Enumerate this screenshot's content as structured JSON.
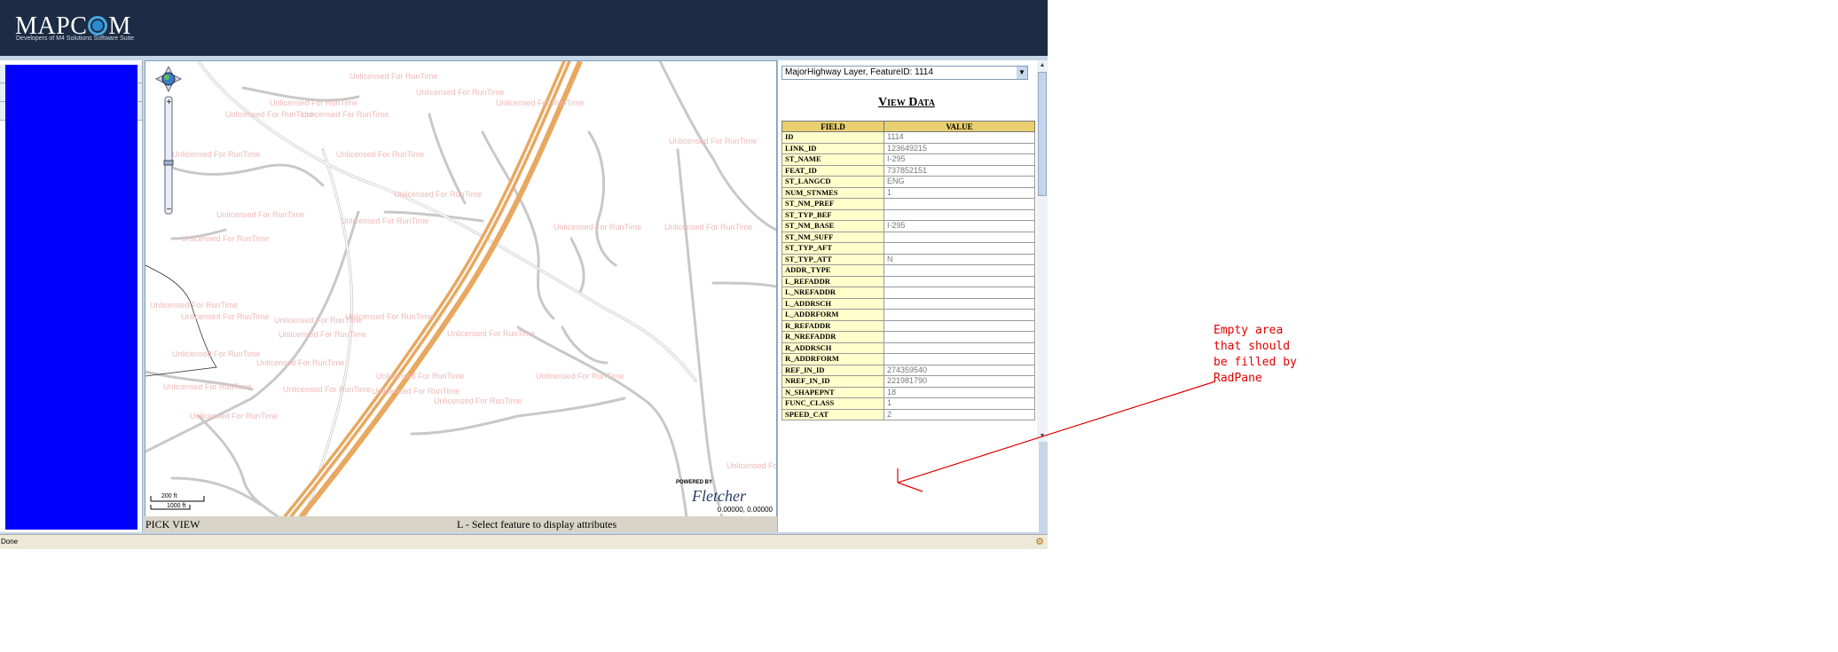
{
  "header": {
    "logo": "MAPCOM",
    "tagline": "Developers of M4 Solutions Software Suite"
  },
  "map": {
    "watermark": "Unlicensed For RunTime",
    "status_mode": "PICK  VIEW",
    "status_message": "L - Select feature to display attributes",
    "coords": "0.00000, 0.00000",
    "scale_labels": [
      "200 ft",
      "1000 ft"
    ],
    "powered_by": "POWERED BY",
    "brand": "Fletcher"
  },
  "attributes": {
    "layer_select": "MajorHighway Layer, FeatureID: 1114",
    "title": "View Data",
    "columns": [
      "FIELD",
      "VALUE"
    ],
    "rows": [
      [
        "ID",
        "1114"
      ],
      [
        "LINK_ID",
        "123649215"
      ],
      [
        "ST_NAME",
        "I-295"
      ],
      [
        "FEAT_ID",
        "737852151"
      ],
      [
        "ST_LANGCD",
        "ENG"
      ],
      [
        "NUM_STNMES",
        "1"
      ],
      [
        "ST_NM_PREF",
        ""
      ],
      [
        "ST_TYP_BEF",
        ""
      ],
      [
        "ST_NM_BASE",
        "I-295"
      ],
      [
        "ST_NM_SUFF",
        ""
      ],
      [
        "ST_TYP_AFT",
        ""
      ],
      [
        "ST_TYP_ATT",
        "N"
      ],
      [
        "ADDR_TYPE",
        ""
      ],
      [
        "L_REFADDR",
        ""
      ],
      [
        "L_NREFADDR",
        ""
      ],
      [
        "L_ADDRSCH",
        ""
      ],
      [
        "L_ADDRFORM",
        ""
      ],
      [
        "R_REFADDR",
        ""
      ],
      [
        "R_NREFADDR",
        ""
      ],
      [
        "R_ADDRSCH",
        ""
      ],
      [
        "R_ADDRFORM",
        ""
      ],
      [
        "REF_IN_ID",
        "274359540"
      ],
      [
        "NREF_IN_ID",
        "221981790"
      ],
      [
        "N_SHAPEPNT",
        "18"
      ],
      [
        "FUNC_CLASS",
        "1"
      ],
      [
        "SPEED_CAT",
        "2"
      ]
    ]
  },
  "browser_status": {
    "text": "Done"
  },
  "annotation": {
    "text": "Empty area\nthat should\nbe filled by\nRadPane"
  },
  "colors": {
    "header": "#1c2c44",
    "blue_panel": "#0000ff",
    "highway": "#e8a860",
    "annotation": "#e00000",
    "table_header": "#e8cf70",
    "field_cell": "#ffffcc"
  }
}
